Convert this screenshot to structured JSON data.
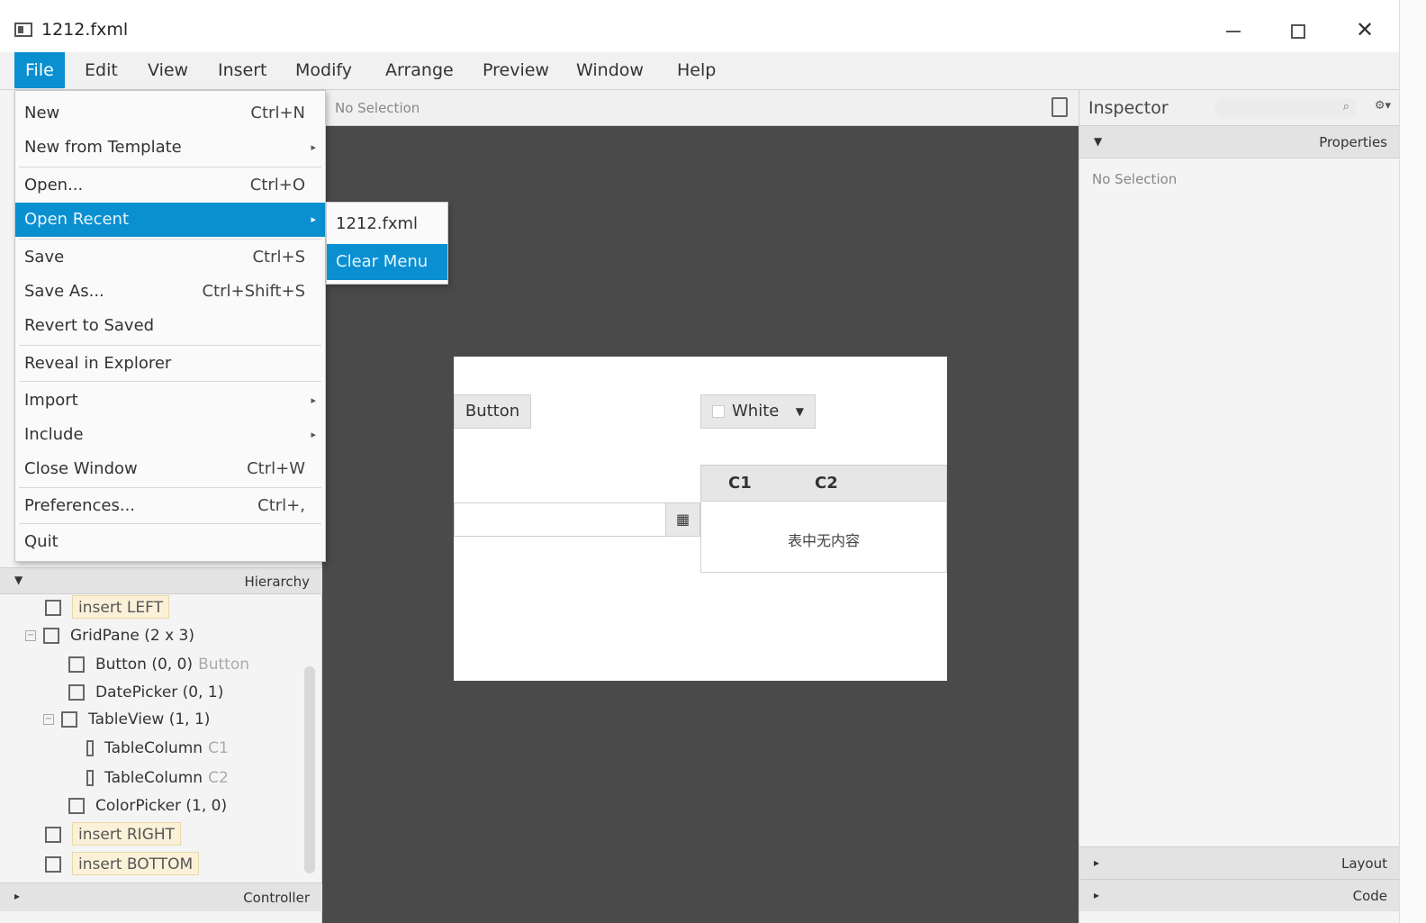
{
  "window": {
    "title": "1212.fxml"
  },
  "menubar": {
    "items": [
      "File",
      "Edit",
      "View",
      "Insert",
      "Modify",
      "Arrange",
      "Preview",
      "Window",
      "Help"
    ]
  },
  "file_menu": {
    "items": [
      {
        "label": "New",
        "accel": "Ctrl+N"
      },
      {
        "label": "New from Template",
        "accel": ""
      },
      {
        "label": "Open...",
        "accel": "Ctrl+O"
      },
      {
        "label": "Open Recent",
        "accel": ""
      },
      {
        "label": "Save",
        "accel": "Ctrl+S"
      },
      {
        "label": "Save As...",
        "accel": "Ctrl+Shift+S"
      },
      {
        "label": "Revert to Saved",
        "accel": ""
      },
      {
        "label": "Reveal in Explorer",
        "accel": ""
      },
      {
        "label": "Import",
        "accel": ""
      },
      {
        "label": "Include",
        "accel": ""
      },
      {
        "label": "Close Window",
        "accel": "Ctrl+W"
      },
      {
        "label": "Preferences...",
        "accel": "Ctrl+,"
      },
      {
        "label": "Quit",
        "accel": ""
      }
    ]
  },
  "recent_submenu": {
    "items": [
      "1212.fxml",
      "Clear Menu"
    ]
  },
  "content_panel": {
    "selection_status": "No Selection"
  },
  "canvas": {
    "button_label": "Button",
    "color_value": "White",
    "table_columns": [
      "C1",
      "C2"
    ],
    "table_placeholder": "表中无内容"
  },
  "hierarchy": {
    "title": "Hierarchy",
    "rows": [
      {
        "name": "insert LEFT",
        "hint": ""
      },
      {
        "name": "GridPane (2 x 3)",
        "hint": ""
      },
      {
        "name": "Button (0, 0)",
        "hint": "Button"
      },
      {
        "name": "DatePicker (0, 1)",
        "hint": ""
      },
      {
        "name": "TableView (1, 1)",
        "hint": ""
      },
      {
        "name": "TableColumn",
        "hint": "C1"
      },
      {
        "name": "TableColumn",
        "hint": "C2"
      },
      {
        "name": "ColorPicker (1, 0)",
        "hint": ""
      },
      {
        "name": "insert RIGHT",
        "hint": ""
      },
      {
        "name": "insert BOTTOM",
        "hint": ""
      }
    ]
  },
  "controller": {
    "title": "Controller"
  },
  "inspector": {
    "title": "Inspector",
    "properties_title": "Properties",
    "selection_status": "No Selection",
    "layout_title": "Layout",
    "code_title": "Code"
  },
  "colors": {
    "accent": "#0a8fd1",
    "canvas_bg": "#4a4a4a"
  }
}
